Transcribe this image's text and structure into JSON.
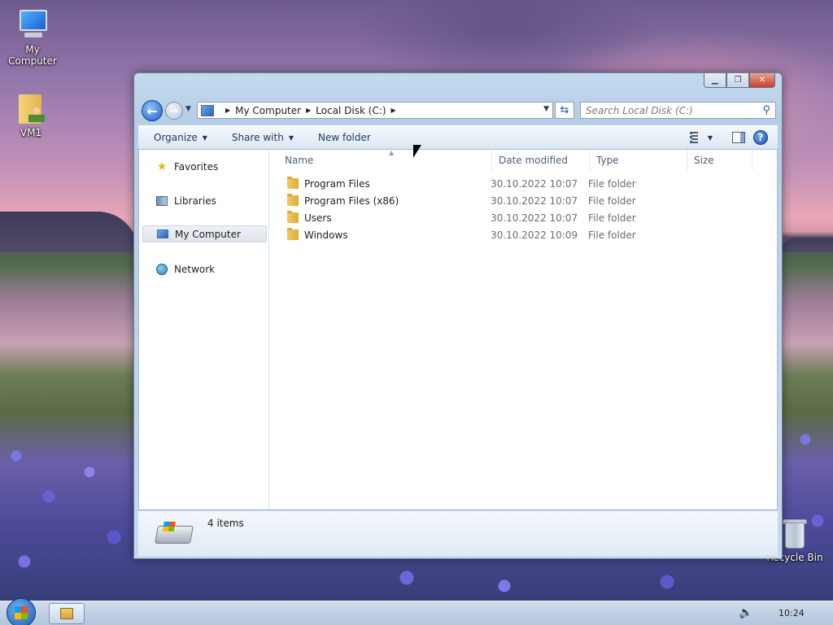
{
  "desktop": {
    "icons": [
      {
        "label": "My Computer"
      },
      {
        "label": "VM1"
      },
      {
        "label": "Recycle Bin"
      }
    ]
  },
  "window": {
    "address": {
      "crumbs": [
        "My Computer",
        "Local Disk (C:)"
      ]
    },
    "search": {
      "placeholder": "Search Local Disk (C:)"
    },
    "toolbar": {
      "organize": "Organize",
      "share_with": "Share with",
      "new_folder": "New folder"
    },
    "nav": {
      "favorites": "Favorites",
      "libraries": "Libraries",
      "my_computer": "My Computer",
      "network": "Network"
    },
    "columns": {
      "name": "Name",
      "date": "Date modified",
      "type": "Type",
      "size": "Size"
    },
    "files": [
      {
        "name": "Program Files",
        "date": "30.10.2022 10:07",
        "type": "File folder"
      },
      {
        "name": "Program Files (x86)",
        "date": "30.10.2022 10:07",
        "type": "File folder"
      },
      {
        "name": "Users",
        "date": "30.10.2022 10:07",
        "type": "File folder"
      },
      {
        "name": "Windows",
        "date": "30.10.2022 10:09",
        "type": "File folder"
      }
    ],
    "details": {
      "count": "4 items"
    }
  },
  "taskbar": {
    "clock": "10:24"
  },
  "icons": {
    "back": "back-arrow-icon",
    "forward": "forward-arrow-icon",
    "refresh": "refresh-icon",
    "search": "search-icon",
    "help": "help-icon"
  },
  "colors": {
    "window_frame": "#b5cde6",
    "close_button": "#c8412a",
    "folder": "#f3cc63"
  }
}
